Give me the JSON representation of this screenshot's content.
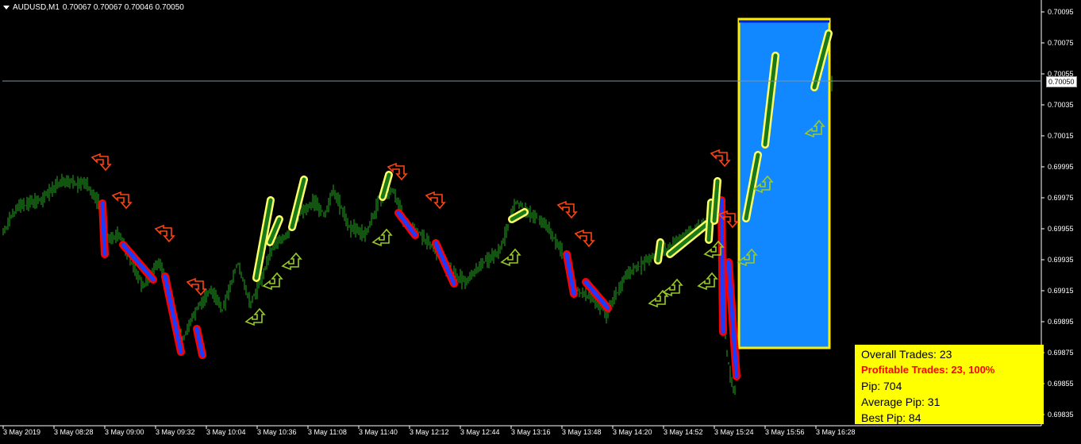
{
  "header": {
    "symbol_timeframe": "AUDUSD,M1",
    "ohlc": "0.70067 0.70067 0.70046 0.70050"
  },
  "current_price": "0.70050",
  "y_axis_labels": [
    "0.70095",
    "0.70075",
    "0.70055",
    "0.70035",
    "0.70015",
    "0.69995",
    "0.69975",
    "0.69955",
    "0.69935",
    "0.69915",
    "0.69895",
    "0.69875",
    "0.69855",
    "0.69835"
  ],
  "x_axis_labels": [
    "3 May 2019",
    "3 May 08:28",
    "3 May 09:00",
    "3 May 09:32",
    "3 May 10:04",
    "3 May 10:36",
    "3 May 11:08",
    "3 May 11:40",
    "3 May 12:12",
    "3 May 12:44",
    "3 May 13:16",
    "3 May 13:48",
    "3 May 14:20",
    "3 May 14:52",
    "3 May 15:24",
    "3 May 15:56",
    "3 May 16:28"
  ],
  "stats": {
    "overall": "Overall Trades: 23",
    "profitable": "Profitable Trades: 23, 100%",
    "pip": "Pip: 704",
    "average": "Average Pip: 31",
    "best": "Best Pip: 84"
  },
  "colors": {
    "bars": "#22aa22",
    "sell_fill": "#1a3cff",
    "sell_outline": "#ff0000",
    "buy_fill": "#1a7a1a",
    "buy_outline": "#ffff66",
    "box_fill": "#1188ff",
    "box_border": "#ffee00",
    "sell_arrow": "#ff4411",
    "buy_arrow": "#99cc22"
  }
}
